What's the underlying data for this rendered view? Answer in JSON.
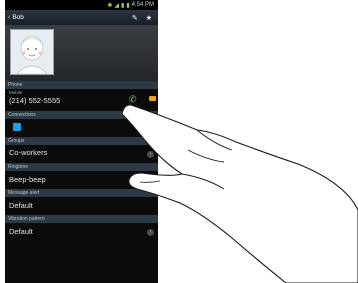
{
  "status": {
    "time": "4:54 PM",
    "icons": [
      "bluetooth-icon",
      "wifi-icon",
      "signal-icon",
      "battery-icon"
    ]
  },
  "header": {
    "back_label": "<",
    "contact_name": "Bob",
    "icons": [
      "edit-icon",
      "favorite-star-icon"
    ]
  },
  "sections": {
    "phone": "Phone",
    "connections": "Connections",
    "groups": "Groups",
    "ringtone": "Ringtone",
    "message_alert": "Message alert",
    "vibration_pattern": "Vibration pattern"
  },
  "phone": {
    "type": "Mobile",
    "number": "(214) 552-5555"
  },
  "groups": {
    "value": "Co-workers"
  },
  "ringtone": {
    "value": "Beep-beep"
  },
  "message_alert": {
    "value": "Default"
  },
  "vibration_pattern": {
    "value": "Default"
  }
}
